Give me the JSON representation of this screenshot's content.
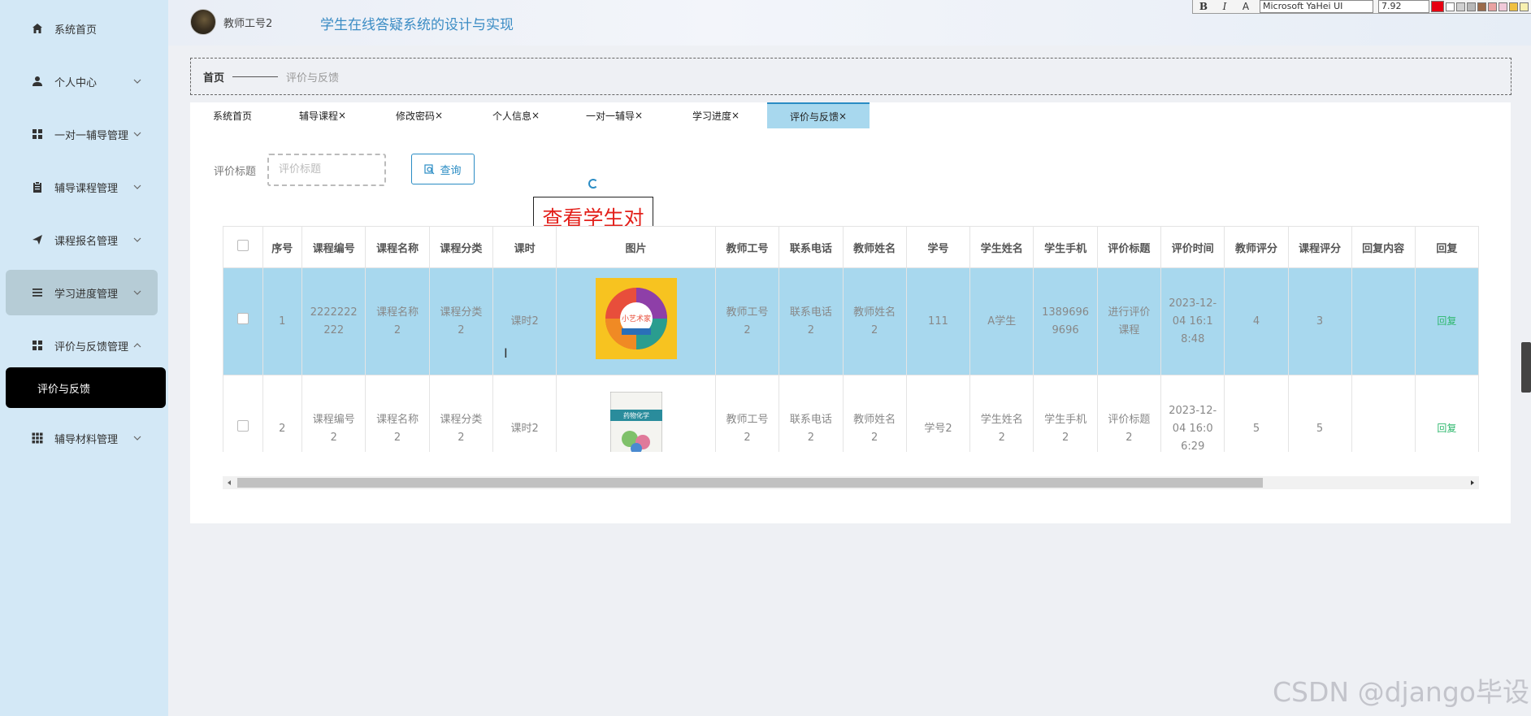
{
  "sidebar": {
    "items": [
      {
        "label": "系统首页",
        "icon": "home-icon",
        "chevron": false
      },
      {
        "label": "个人中心",
        "icon": "user-icon",
        "chevron": true
      },
      {
        "label": "一对一辅导管理",
        "icon": "grid-icon",
        "chevron": true
      },
      {
        "label": "辅导课程管理",
        "icon": "clipboard-icon",
        "chevron": true
      },
      {
        "label": "课程报名管理",
        "icon": "send-icon",
        "chevron": true
      },
      {
        "label": "学习进度管理",
        "icon": "list-icon",
        "chevron": true
      },
      {
        "label": "评价与反馈管理",
        "icon": "grid-icon",
        "chevron": true
      },
      {
        "label": "辅导材料管理",
        "icon": "apps-icon",
        "chevron": true
      }
    ],
    "sub_item": "评价与反馈"
  },
  "header": {
    "teacher_name": "教师工号2",
    "system_title": "学生在线答疑系统的设计与实现"
  },
  "format_toolbar": {
    "bold": "B",
    "italic": "I",
    "font_a": "A",
    "font_name": "Microsoft YaHei UI",
    "font_size": "7.92",
    "colors": [
      "#e60012",
      "#ffffff",
      "#d0d0d0",
      "#b8b8b8",
      "#9b6a4a",
      "#e9a2a2",
      "#f0c8d8",
      "#f0c040",
      "#f8f0b0"
    ]
  },
  "breadcrumb": {
    "home": "首页",
    "current": "评价与反馈"
  },
  "tabs": [
    {
      "label": "系统首页",
      "closable": false
    },
    {
      "label": "辅导课程",
      "closable": true
    },
    {
      "label": "修改密码",
      "closable": true
    },
    {
      "label": "个人信息",
      "closable": true
    },
    {
      "label": "一对一辅导",
      "closable": true
    },
    {
      "label": "学习进度",
      "closable": true
    },
    {
      "label": "评价与反馈",
      "closable": true,
      "active": true
    }
  ],
  "search": {
    "label": "评价标题",
    "placeholder": "评价标题",
    "button": "查询"
  },
  "tooltip": "查看学生对",
  "table": {
    "headers": [
      "序号",
      "课程编号",
      "课程名称",
      "课程分类",
      "课时",
      "图片",
      "教师工号",
      "联系电话",
      "教师姓名",
      "学号",
      "学生姓名",
      "学生手机",
      "评价标题",
      "评价时间",
      "教师评分",
      "课程评分",
      "回复内容",
      "回复"
    ],
    "rows": [
      {
        "index": "1",
        "course_no": "2222222222",
        "course_name": "课程名称2",
        "category": "课程分类2",
        "hours": "课时2",
        "image": "book-cover-colorful",
        "teacher_no": "教师工号2",
        "phone": "联系电话2",
        "teacher_name": "教师姓名2",
        "student_no": "111",
        "student_name": "A学生",
        "student_phone": "13896969696",
        "review_title": "进行评价课程",
        "review_time": "2023-12-04 16:18:48",
        "teacher_score": "4",
        "course_score": "3",
        "reply_content": "",
        "reply": "回复"
      },
      {
        "index": "2",
        "course_no": "课程编号2",
        "course_name": "课程名称2",
        "category": "课程分类2",
        "hours": "课时2",
        "image": "book-cover-chemistry",
        "teacher_no": "教师工号2",
        "phone": "联系电话2",
        "teacher_name": "教师姓名2",
        "student_no": "学号2",
        "student_name": "学生姓名2",
        "student_phone": "学生手机2",
        "review_title": "评价标题2",
        "review_time": "2023-12-04 16:06:29",
        "teacher_score": "5",
        "course_score": "5",
        "reply_content": "",
        "reply": "回复"
      }
    ],
    "book1_title": "小艺术家",
    "book2_title": "药物化学"
  },
  "watermark": "CSDN @django毕设"
}
